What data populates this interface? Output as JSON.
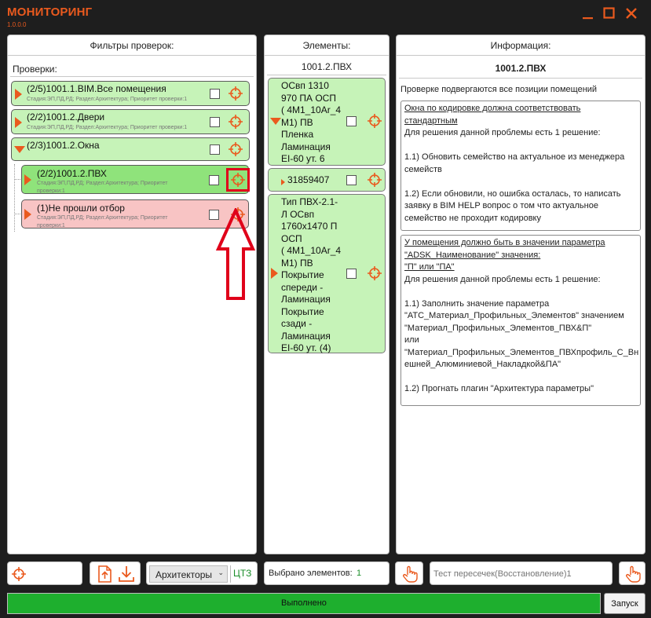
{
  "app": {
    "title": "МОНИТОРИНГ",
    "version": "1.0.0.0"
  },
  "filters": {
    "header": "Фильтры проверок:",
    "sub_label": "Проверки:",
    "items": [
      {
        "title": "(2/5)1001.1.BIM.Все помещения",
        "subtitle": "Стадия:ЭП,ПД,РД; Раздел:Архитектура; Приоритет проверки:1"
      },
      {
        "title": "(2/2)1001.2.Двери",
        "subtitle": "Стадия:ЭП,ПД,РД; Раздел:Архитектура; Приоритет проверки:1"
      },
      {
        "title": "(2/3)1001.2.Окна",
        "subtitle": ""
      },
      {
        "title": "(2/2)1001.2.ПВХ",
        "subtitle": "Стадия:ЭП,ПД,РД; Раздел:Архитектура; Приоритет\nпроверки:1"
      },
      {
        "title": "(1)Не прошли отбор",
        "subtitle": "Стадия:ЭП,ПД,РД; Раздел:Архитектура; Приоритет\nпроверки:1"
      }
    ]
  },
  "elements": {
    "header": "Элементы:",
    "sub_label": "1001.2.ПВХ",
    "items": [
      {
        "text": "ОСвп 1310\n970 ПА ОСП\n( 4М1_10Ar_4\nМ1) ПВ\nПленка\nЛаминация\nEI-60 ут. 6"
      },
      {
        "text": "31859407"
      },
      {
        "text": "Тип ПВХ-2.1-\nЛ ОСвп\n1760х1470 П\nОСП\n( 4М1_10Ar_4\nМ1) ПВ\nПокрытие\nспереди -\nЛаминация\nПокрытие\nсзади -\nЛаминация\nEI-60 ут. (4)"
      }
    ]
  },
  "info": {
    "header": "Информация:",
    "sub_label": "1001.2.ПВХ",
    "intro": "Проверке подвергаются все позиции помещений",
    "box1": {
      "heading": "Окна по кодировке должна соответствовать\nстандартным",
      "body": "\nДля решения данной проблемы есть 1 решение:\n\n1.1) Обновить семейство на актуальное из менеджера\nсемейств\n\n1.2) Если обновили, но ошибка осталась, то написать\nзаявку в BIM HELP вопрос о том что актуальное\nсемейство не проходит кодировку"
    },
    "box2": {
      "heading": "У помещения должно быть в значении параметра\n\"ADSK_Наименование\" значения:\n\"П\" или \"ПА\"",
      "body": "\nДля решения данной проблемы есть 1 решение:\n\n1.1) Заполнить значение параметра\n\"АТС_Материал_Профильных_Элементов\" значением\n\"Материал_Профильных_Элементов_ПВХ&П\"\nили\n\"Материал_Профильных_Элементов_ПВХпрофиль_С_Вн\nешней_Алюминиевой_Накладкой&ПА\"\n\n1.2) Прогнать плагин \"Архитектура параметры\""
    }
  },
  "bottom": {
    "discipline": "Архитекторы",
    "ctz": "ЦТЗ",
    "selected_label": "Выбрано элементов:",
    "selected_count": "1",
    "search_placeholder": "Тест пересечек(Восстановление)1",
    "progress_text": "Выполнено",
    "progress_value": 1.0,
    "run_label": "Запуск"
  },
  "colors": {
    "accent": "#ea5a1e",
    "green": "#c6f3b8",
    "green_selected": "#8fe37b",
    "red_row": "#f8c4c4",
    "progress": "#1eaf2e"
  },
  "icons": [
    "minimize-icon",
    "maximize-icon",
    "close-icon",
    "target-icon",
    "export-icon",
    "download-icon",
    "hand-pointer-icon",
    "up-arrow-annotation"
  ]
}
